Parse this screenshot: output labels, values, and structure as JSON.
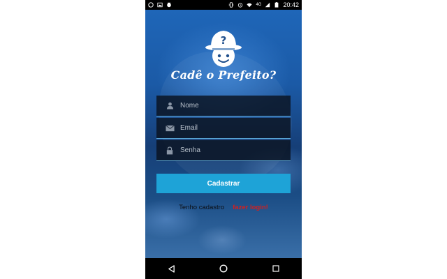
{
  "status_bar": {
    "time": "20:42",
    "network": "4G",
    "left_icons": [
      "whatsapp-icon",
      "image-icon",
      "app-icon"
    ],
    "right_icons": [
      "vibrate-icon",
      "alarm-icon",
      "wifi-icon",
      "signal-icon",
      "battery-icon"
    ]
  },
  "app": {
    "title": "Cadê o Prefeito?",
    "logo_symbol": "?"
  },
  "form": {
    "name_placeholder": "Nome",
    "email_placeholder": "Email",
    "password_placeholder": "Senha",
    "submit_label": "Cadastrar"
  },
  "login": {
    "text": "Tenho cadastro",
    "link": "fazer login!"
  },
  "colors": {
    "button": "#1ea3d7",
    "link": "#d21f1f",
    "field_bg": "#0a1220"
  }
}
